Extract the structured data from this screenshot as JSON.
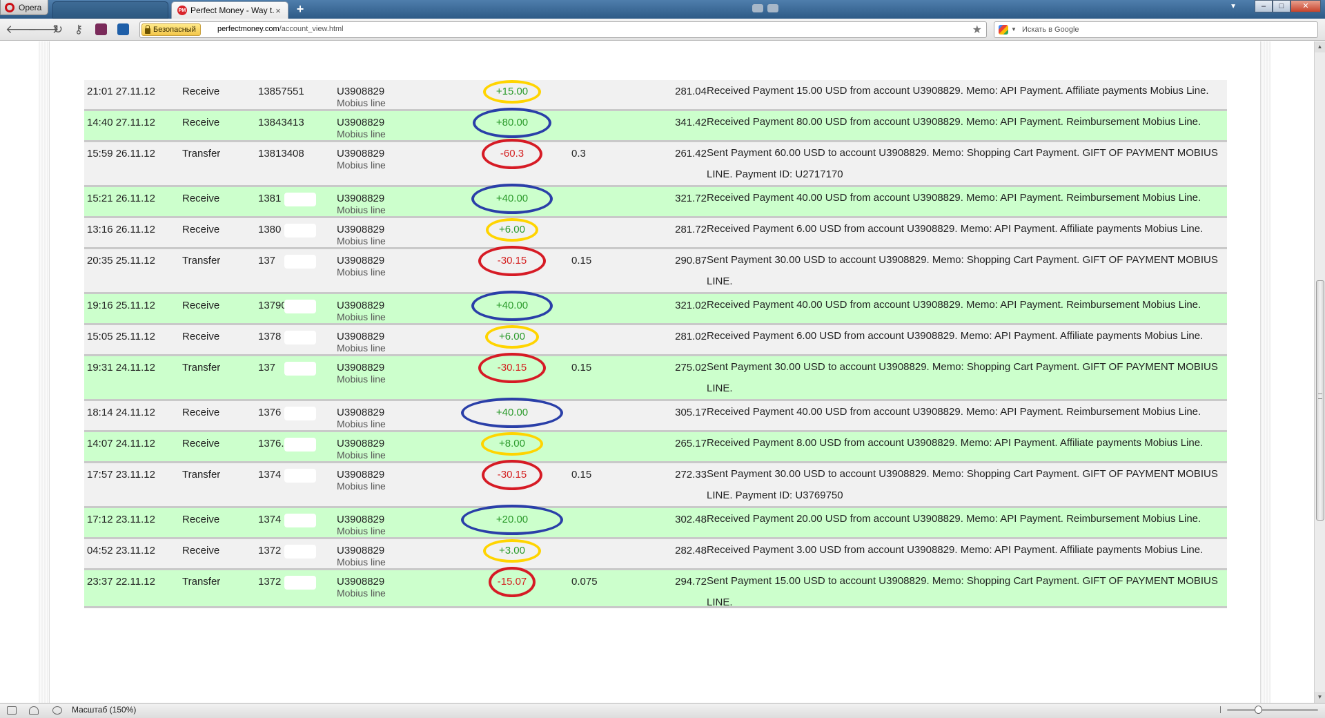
{
  "browser": {
    "app_name": "Opera",
    "active_tab": {
      "title": "Perfect Money - Way t...",
      "favicon": "PM"
    },
    "address": {
      "security_label": "Безопасный",
      "url_host": "perfectmoney.com",
      "url_path": "/account_view.html"
    },
    "search_placeholder": "Искать в Google",
    "status": {
      "zoom_label": "Масштаб (150%)"
    }
  },
  "colors": {
    "row_green": "#ccffcc",
    "row_gray": "#f1f1f1",
    "amount_positive": "#2a9a2a",
    "amount_negative": "#d42020",
    "ring_yellow": "#ffd400",
    "ring_blue": "#2a3fa8",
    "ring_red": "#d61b25"
  },
  "transactions": [
    {
      "datetime": "21:01 27.11.12",
      "type": "Receive",
      "batch": "13857551",
      "account": "U3908829",
      "account_name": "Mobius line",
      "amount": "+15.00",
      "fee": "",
      "balance": "281.04",
      "description": "Received Payment 15.00 USD from account U3908829. Memo: API Payment. Affiliate payments Mobius Line.",
      "row": "gray",
      "ring": "yellow",
      "masked": false
    },
    {
      "datetime": "14:40 27.11.12",
      "type": "Receive",
      "batch": "13843413",
      "account": "U3908829",
      "account_name": "Mobius line",
      "amount": "+80.00",
      "fee": "",
      "balance": "341.42",
      "description": "Received Payment 80.00 USD from account U3908829. Memo: API Payment. Reimbursement Mobius Line.",
      "row": "green",
      "ring": "blue",
      "masked": false
    },
    {
      "datetime": "15:59 26.11.12",
      "type": "Transfer",
      "batch": "13813408",
      "account": "U3908829",
      "account_name": "Mobius line",
      "amount": "-60.3",
      "fee": "0.3",
      "balance": "261.42",
      "description": "Sent Payment 60.00 USD to account U3908829. Memo: Shopping Cart Payment. GIFT OF PAYMENT MOBIUS LINE. Payment ID: U2717170",
      "row": "gray",
      "ring": "red",
      "masked": false
    },
    {
      "datetime": "15:21 26.11.12",
      "type": "Receive",
      "batch": "1381",
      "account": "U3908829",
      "account_name": "Mobius line",
      "amount": "+40.00",
      "fee": "",
      "balance": "321.72",
      "description": "Received Payment 40.00 USD from account U3908829. Memo: API Payment. Reimbursement Mobius Line.",
      "row": "green",
      "ring": "blue",
      "masked": true
    },
    {
      "datetime": "13:16 26.11.12",
      "type": "Receive",
      "batch": "1380",
      "account": "U3908829",
      "account_name": "Mobius line",
      "amount": "+6.00",
      "fee": "",
      "balance": "281.72",
      "description": "Received Payment 6.00 USD from account U3908829. Memo: API Payment. Affiliate payments Mobius Line.",
      "row": "gray",
      "ring": "yellow",
      "masked": true
    },
    {
      "datetime": "20:35 25.11.12",
      "type": "Transfer",
      "batch": "137",
      "account": "U3908829",
      "account_name": "Mobius line",
      "amount": "-30.15",
      "fee": "0.15",
      "balance": "290.87",
      "description": "Sent Payment 30.00 USD to account U3908829. Memo: Shopping Cart Payment. GIFT OF PAYMENT MOBIUS LINE.",
      "row": "gray",
      "ring": "red",
      "masked": true
    },
    {
      "datetime": "19:16 25.11.12",
      "type": "Receive",
      "batch": "13790",
      "account": "U3908829",
      "account_name": "Mobius line",
      "amount": "+40.00",
      "fee": "",
      "balance": "321.02",
      "description": "Received Payment 40.00 USD from account U3908829. Memo: API Payment. Reimbursement Mobius Line.",
      "row": "green",
      "ring": "blue",
      "masked": true
    },
    {
      "datetime": "15:05 25.11.12",
      "type": "Receive",
      "batch": "1378",
      "account": "U3908829",
      "account_name": "Mobius line",
      "amount": "+6.00",
      "fee": "",
      "balance": "281.02",
      "description": "Received Payment 6.00 USD from account U3908829. Memo: API Payment. Affiliate payments Mobius Line.",
      "row": "gray",
      "ring": "yellow",
      "masked": true
    },
    {
      "datetime": "19:31 24.11.12",
      "type": "Transfer",
      "batch": "137",
      "account": "U3908829",
      "account_name": "Mobius line",
      "amount": "-30.15",
      "fee": "0.15",
      "balance": "275.02",
      "description": "Sent Payment 30.00 USD to account U3908829. Memo: Shopping Cart Payment. GIFT OF PAYMENT MOBIUS LINE.",
      "row": "green",
      "ring": "red",
      "masked": true
    },
    {
      "datetime": "18:14 24.11.12",
      "type": "Receive",
      "batch": "1376",
      "account": "U3908829",
      "account_name": "Mobius line",
      "amount": "+40.00",
      "fee": "",
      "balance": "305.17",
      "description": "Received Payment 40.00 USD from account U3908829. Memo: API Payment. Reimbursement Mobius Line.",
      "row": "gray",
      "ring": "blue",
      "masked": true
    },
    {
      "datetime": "14:07 24.11.12",
      "type": "Receive",
      "batch": "1376.",
      "account": "U3908829",
      "account_name": "Mobius line",
      "amount": "+8.00",
      "fee": "",
      "balance": "265.17",
      "description": "Received Payment 8.00 USD from account U3908829. Memo: API Payment. Affiliate payments Mobius Line.",
      "row": "green",
      "ring": "yellow",
      "masked": true
    },
    {
      "datetime": "17:57 23.11.12",
      "type": "Transfer",
      "batch": "1374",
      "account": "U3908829",
      "account_name": "Mobius line",
      "amount": "-30.15",
      "fee": "0.15",
      "balance": "272.33",
      "description": "Sent Payment 30.00 USD to account U3908829. Memo: Shopping Cart Payment. GIFT OF PAYMENT MOBIUS LINE. Payment ID: U3769750",
      "row": "gray",
      "ring": "red",
      "masked": true
    },
    {
      "datetime": "17:12 23.11.12",
      "type": "Receive",
      "batch": "1374",
      "account": "U3908829",
      "account_name": "Mobius line",
      "amount": "+20.00",
      "fee": "",
      "balance": "302.48",
      "description": "Received Payment 20.00 USD from account U3908829. Memo: API Payment. Reimbursement Mobius Line.",
      "row": "green",
      "ring": "blue",
      "masked": true
    },
    {
      "datetime": "04:52 23.11.12",
      "type": "Receive",
      "batch": "1372",
      "account": "U3908829",
      "account_name": "Mobius line",
      "amount": "+3.00",
      "fee": "",
      "balance": "282.48",
      "description": "Received Payment 3.00 USD from account U3908829. Memo: API Payment. Affiliate payments Mobius Line.",
      "row": "gray",
      "ring": "yellow",
      "masked": true
    },
    {
      "datetime": "23:37 22.11.12",
      "type": "Transfer",
      "batch": "1372",
      "account": "U3908829",
      "account_name": "Mobius line",
      "amount": "-15.07",
      "fee": "0.075",
      "balance": "294.72",
      "description": "Sent Payment 15.00 USD to account U3908829. Memo: Shopping Cart Payment. GIFT OF PAYMENT MOBIUS LINE.",
      "row": "green",
      "ring": "red",
      "masked": true
    }
  ]
}
